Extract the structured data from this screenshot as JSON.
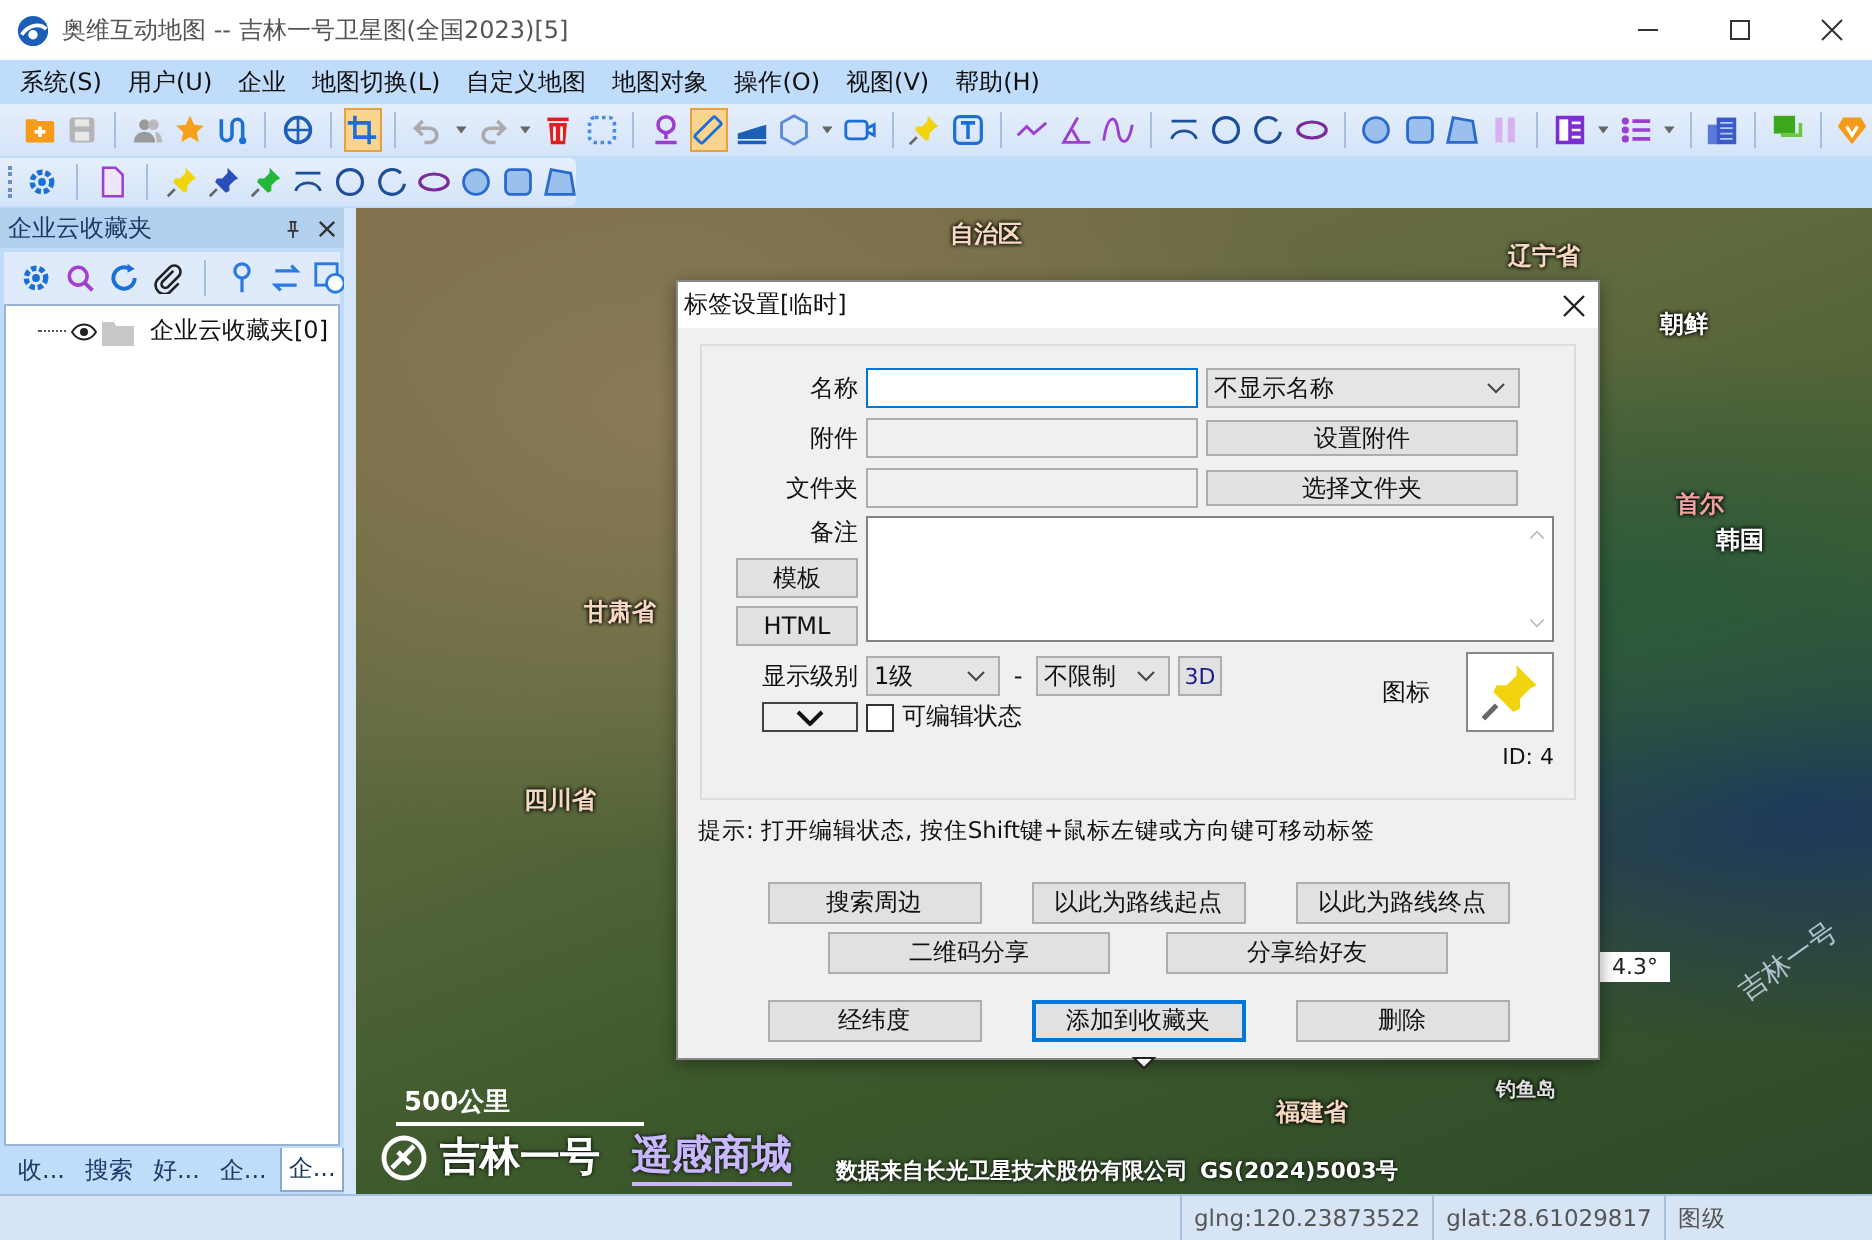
{
  "window": {
    "title": "奥维互动地图 -- 吉林一号卫星图(全国2023)[5]"
  },
  "menu": [
    "系统(S)",
    "用户(U)",
    "企业",
    "地图切换(L)",
    "自定义地图",
    "地图对象",
    "操作(O)",
    "视图(V)",
    "帮助(H)"
  ],
  "toolbar": [
    {
      "selected": false
    },
    {
      "selected": false
    },
    {
      "selected": false
    },
    {
      "selected": false
    },
    {
      "selected": false
    },
    {
      "selected": false
    },
    {
      "selected": true
    },
    {
      "selected": false
    },
    {
      "selected": false
    },
    {
      "selected": false
    },
    {
      "selected": false
    },
    {
      "selected": false
    },
    {
      "selected": true
    },
    {
      "selected": false
    },
    {
      "selected": false
    },
    {
      "selected": false
    },
    {
      "selected": false
    },
    {
      "selected": false
    },
    {
      "selected": false
    },
    {
      "selected": false
    },
    {
      "selected": false
    },
    {
      "selected": false
    },
    {
      "selected": false
    },
    {
      "selected": false
    },
    {
      "selected": false
    },
    {
      "selected": false
    },
    {
      "selected": false
    },
    {
      "selected": false
    },
    {
      "selected": false
    },
    {
      "selected": false
    },
    {
      "selected": false
    },
    {
      "selected": false
    },
    {
      "selected": false
    },
    {
      "selected": false
    }
  ],
  "side_panel": {
    "title": "企业云收藏夹",
    "tree": [
      {
        "label": "企业云收藏夹[0]"
      }
    ],
    "tabs": [
      {
        "label": "收...",
        "selected": false
      },
      {
        "label": "搜索",
        "selected": false
      },
      {
        "label": "好...",
        "selected": false
      },
      {
        "label": "企...",
        "selected": false
      },
      {
        "label": "企...",
        "selected": true
      }
    ]
  },
  "map": {
    "labels": [
      {
        "text": "自治区",
        "kind": "region"
      },
      {
        "text": "辽宁省",
        "kind": "region"
      },
      {
        "text": "朝鲜",
        "kind": "country"
      },
      {
        "text": "首尔",
        "kind": "capital"
      },
      {
        "text": "韩国",
        "kind": "country"
      },
      {
        "text": "甘肃省",
        "kind": "region"
      },
      {
        "text": "四川省",
        "kind": "region"
      },
      {
        "text": "福建省",
        "kind": "region"
      },
      {
        "text": "钓鱼岛",
        "kind": "island"
      },
      {
        "text": "吉林一号",
        "kind": "tile-mark"
      }
    ],
    "angle_tag": "4.3°",
    "scale": "500公里",
    "brand": "吉林一号",
    "shop_link": "遥感商城",
    "credit": "数据来自长光卫星技术股份有限公司",
    "approval": "GS(2024)5003号"
  },
  "dialog": {
    "title": "标签设置[临时]",
    "name_label": "名称",
    "name_display": "不显示名称",
    "attachment_label": "附件",
    "attachment_button": "设置附件",
    "folder_label": "文件夹",
    "folder_button": "选择文件夹",
    "note_label": "备注",
    "template_button": "模板",
    "html_button": "HTML",
    "level_label": "显示级别",
    "level_min": "1级",
    "level_dash": "-",
    "level_max": "不限制",
    "button_3d": "3D",
    "editable": {
      "label": "可编辑状态",
      "checked": false
    },
    "icon_label": "图标",
    "id": "ID: 4",
    "hint": "提示: 打开编辑状态, 按住Shift键+鼠标左键或方向键可移动标签",
    "action_rows": [
      [
        "搜索周边",
        "以此为路线起点",
        "以此为路线终点"
      ],
      [
        "二维码分享",
        "分享给好友"
      ]
    ],
    "bottom_buttons": [
      {
        "label": "经纬度",
        "focused": false
      },
      {
        "label": "添加到收藏夹",
        "focused": true
      },
      {
        "label": "删除",
        "focused": false
      }
    ]
  },
  "status_bar": {
    "fields": [
      "glng:120.23873522",
      "glat:28.61029817",
      "图级"
    ]
  }
}
